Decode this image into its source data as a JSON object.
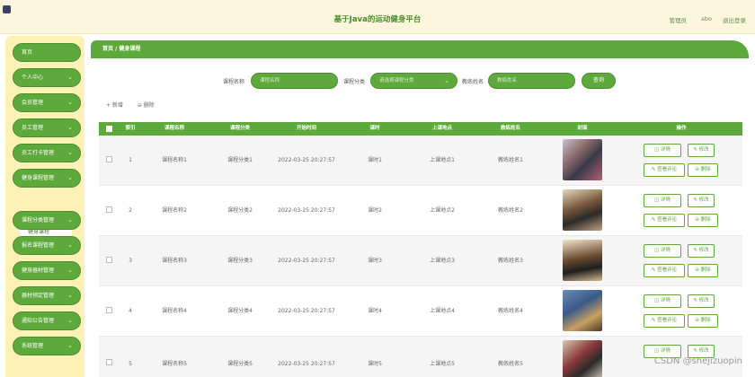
{
  "header": {
    "title": "基于Java的运动健身平台",
    "admin_label": "管理员",
    "admin_name": "abo",
    "logout": "退出登录"
  },
  "sidebar": {
    "items": [
      {
        "label": "首页",
        "chevron": ""
      },
      {
        "label": "个人中心",
        "chevron": "⌄"
      },
      {
        "label": "会员管理",
        "chevron": "⌄"
      },
      {
        "label": "员工管理",
        "chevron": "⌄"
      },
      {
        "label": "员工打卡管理",
        "chevron": "⌄"
      },
      {
        "label": "健身课程管理",
        "chevron": "⌄"
      },
      {
        "label": "课程分类管理",
        "chevron": "⌄"
      },
      {
        "label": "报名课程管理",
        "chevron": "⌄"
      },
      {
        "label": "健身器材管理",
        "chevron": "⌄"
      },
      {
        "label": "器材预定管理",
        "chevron": "⌄"
      },
      {
        "label": "通知公告管理",
        "chevron": "⌄"
      },
      {
        "label": "系统管理",
        "chevron": "⌄"
      }
    ],
    "active_submenu": "健身课程"
  },
  "breadcrumb": "首页 / 健身课程",
  "search": {
    "course_name_label": "课程名称",
    "course_name_placeholder": "课程名称",
    "category_label": "课程分类",
    "category_placeholder": "请选择课程分类",
    "coach_label": "教练姓名",
    "coach_placeholder": "教练姓名",
    "query_button": "查询"
  },
  "actions": {
    "add": "+ 新增",
    "delete": "⊖ 删除"
  },
  "table": {
    "columns": [
      "索引",
      "课程名称",
      "课程分类",
      "开始时间",
      "课时",
      "上课地点",
      "教练姓名",
      "封面",
      "操作"
    ],
    "rows": [
      {
        "index": "1",
        "name": "课程名称1",
        "category": "课程分类1",
        "start": "2022-03-25 20:27:57",
        "hours": "课时1",
        "place": "上课地点1",
        "coach": "教练姓名1"
      },
      {
        "index": "2",
        "name": "课程名称2",
        "category": "课程分类2",
        "start": "2022-03-25 20:27:57",
        "hours": "课时2",
        "place": "上课地点2",
        "coach": "教练姓名2"
      },
      {
        "index": "3",
        "name": "课程名称3",
        "category": "课程分类3",
        "start": "2022-03-25 20:27:57",
        "hours": "课时3",
        "place": "上课地点3",
        "coach": "教练姓名3"
      },
      {
        "index": "4",
        "name": "课程名称4",
        "category": "课程分类4",
        "start": "2022-03-25 20:27:57",
        "hours": "课时4",
        "place": "上课地点4",
        "coach": "教练姓名4"
      },
      {
        "index": "5",
        "name": "课程名称5",
        "category": "课程分类5",
        "start": "2022-03-25 20:27:57",
        "hours": "课时5",
        "place": "上课地点5",
        "coach": "教练姓名5"
      }
    ],
    "row_buttons": {
      "detail": "◫ 详情",
      "edit": "✎ 修改",
      "comment": "✎ 查看评论",
      "remove": "⊖ 删除"
    }
  },
  "watermark": "CSDN @shejizuopin",
  "colors": {
    "accent": "#5ea93c",
    "header_bg": "#fbf6dc",
    "sidebar_bg": "#fdf1b5"
  }
}
